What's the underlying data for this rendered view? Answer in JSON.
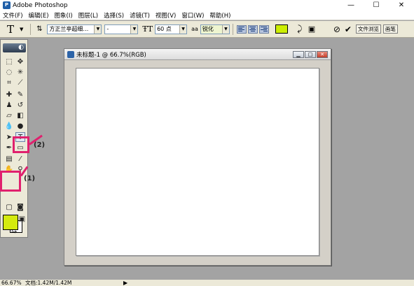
{
  "app": {
    "title": "Adobe Photoshop"
  },
  "window_controls": {
    "minimize": "—",
    "maximize": "☐",
    "close": "✕"
  },
  "menubar": {
    "items": [
      "文件(F)",
      "编辑(E)",
      "图象(I)",
      "图层(L)",
      "选择(S)",
      "滤镜(T)",
      "视图(V)",
      "窗口(W)",
      "帮助(H)"
    ]
  },
  "options_bar": {
    "tool_glyph": "T",
    "font_family": "方正兰亭超细…",
    "font_style": "-",
    "font_size": "60 点",
    "antialias": "锐化",
    "text_color": "#ccee00",
    "palette_button": "文件浏览",
    "brushes_button": "画笔"
  },
  "document": {
    "title": "未标题-1 @ 66.7%(RGB)"
  },
  "toolbox": {
    "foreground_color": "#d4ea0e",
    "background_color": "#ffffff"
  },
  "annotations": {
    "label_1": "(1)",
    "label_2": "(2)",
    "color": "#e0206e"
  },
  "statusbar": {
    "zoom": "66.67%",
    "doc_info": "文档:1.42M/1.42M"
  }
}
